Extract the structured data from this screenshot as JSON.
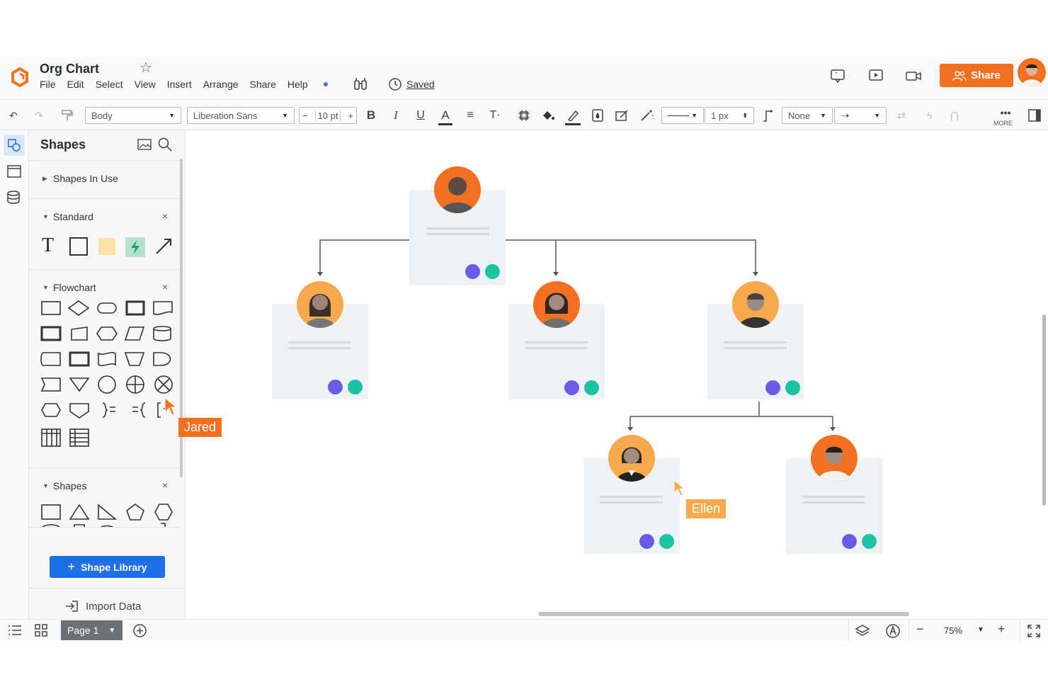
{
  "header": {
    "title": "Org Chart",
    "menu": [
      "File",
      "Edit",
      "Select",
      "View",
      "Insert",
      "Arrange",
      "Share",
      "Help"
    ],
    "saved": "Saved",
    "share": "Share"
  },
  "toolbar": {
    "style_select": "Body",
    "font_select": "Liberation Sans",
    "font_size": "10 pt",
    "line_width": "1 px",
    "line_start": "None",
    "more": "MORE"
  },
  "sidebar": {
    "title": "Shapes",
    "sections": [
      {
        "label": "Shapes In Use",
        "collapsed": true
      },
      {
        "label": "Standard",
        "collapsed": false
      },
      {
        "label": "Flowchart",
        "collapsed": false
      },
      {
        "label": "Shapes",
        "collapsed": false
      }
    ],
    "shape_library": "Shape Library",
    "import": "Import Data"
  },
  "collaborators": [
    {
      "name": "Jared",
      "color": "#f37021"
    },
    {
      "name": "Ellen",
      "color": "#f9a94d"
    }
  ],
  "footer": {
    "page": "Page 1",
    "zoom": "75%"
  },
  "colors": {
    "accent": "#f37021",
    "primary": "#1e6fe8",
    "phone": "#6b5ce7",
    "profile": "#19c3a3"
  }
}
